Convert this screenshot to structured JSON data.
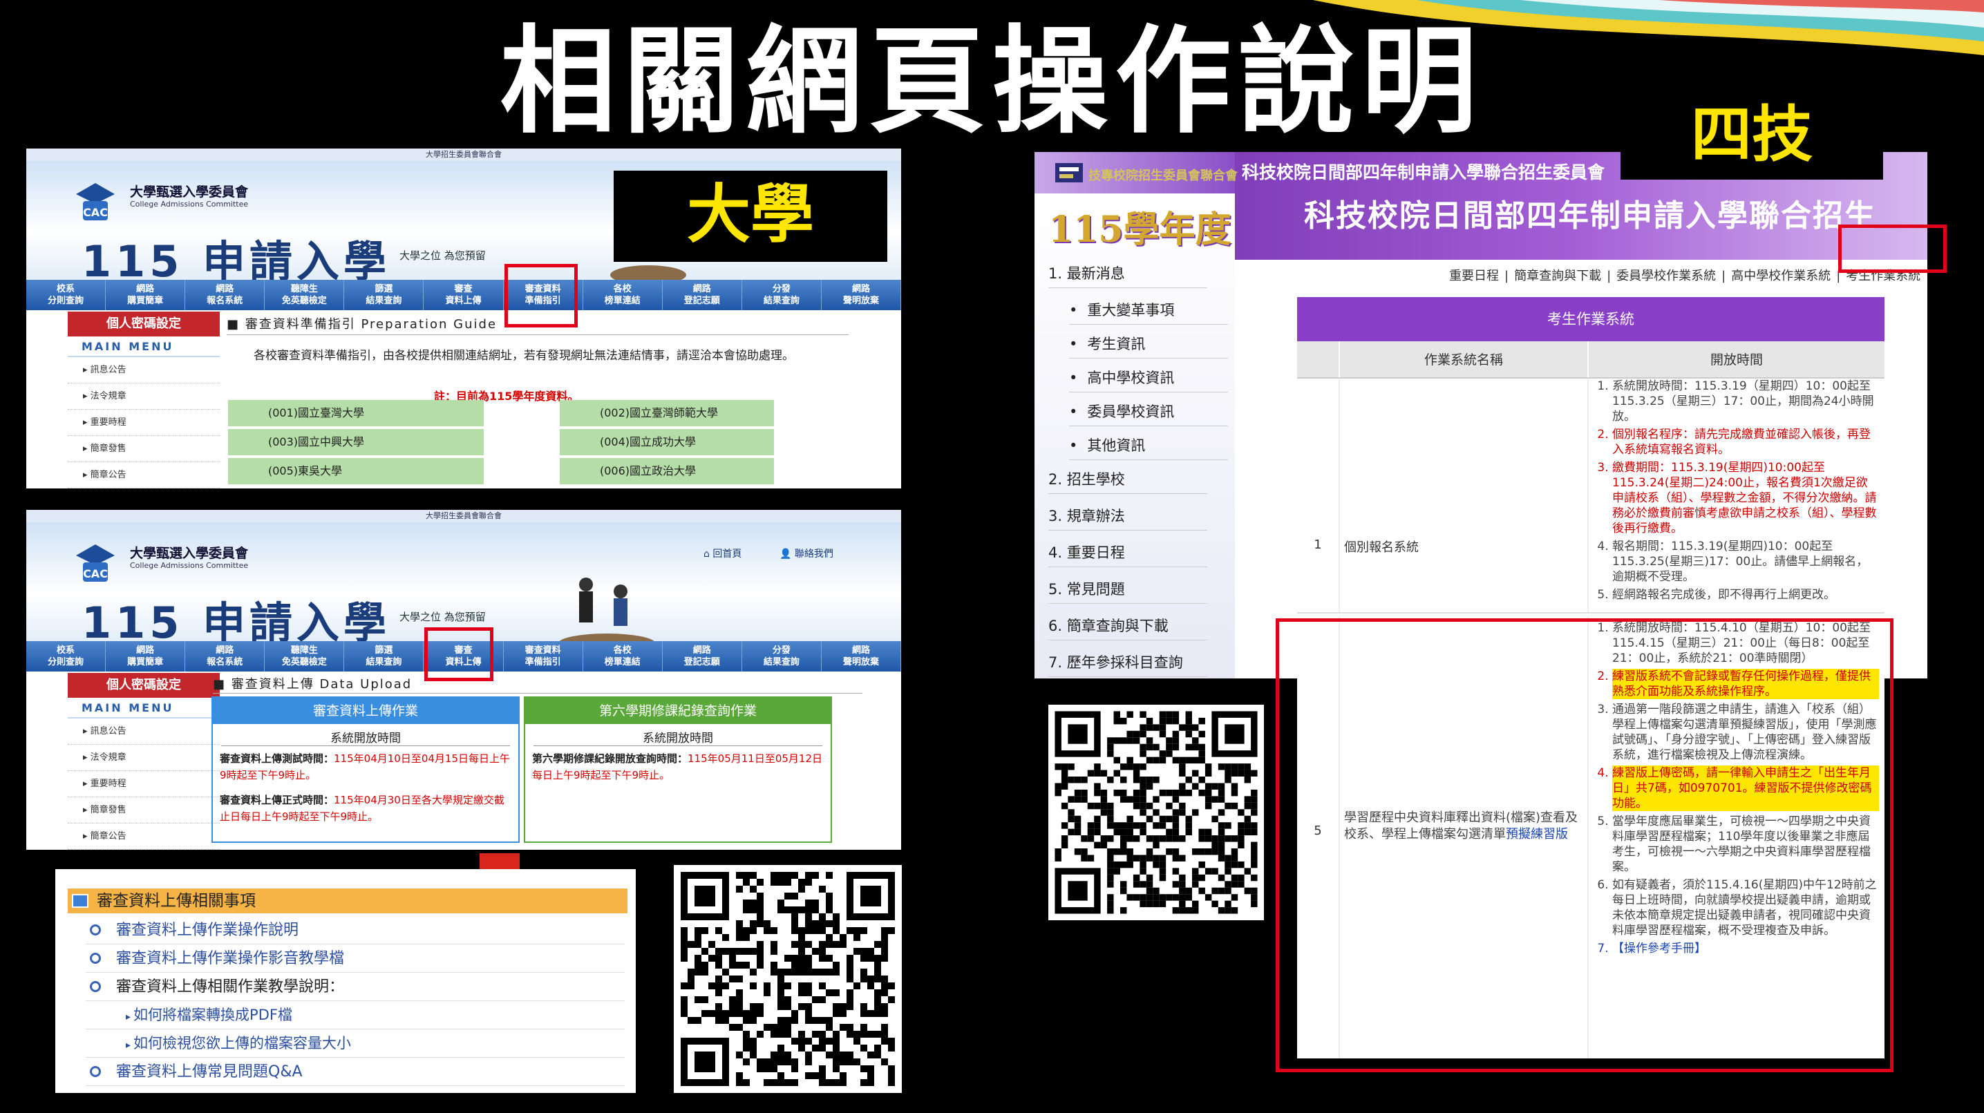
{
  "slide": {
    "title": "相關網頁操作說明",
    "label_univ": "大學",
    "label_tech": "四技"
  },
  "cac": {
    "top_bar": "大學招生委員會聯合會",
    "org_name": "大學甄選入學委員會",
    "org_en": "College Admissions Committee",
    "big_title": "115 申請入學",
    "tagline": "大學之位 為您預留",
    "nav": [
      "校系\n分則查詢",
      "網路\n購買簡章",
      "網路\n報名系統",
      "聽障生\n免英聽檢定",
      "篩選\n結果查詢",
      "審查\n資料上傳",
      "審查資料\n準備指引",
      "各校\n榜單連結",
      "網路\n登記志願",
      "分發\n結果查詢",
      "網路\n聲明放棄"
    ],
    "side_head": "個人密碼設定",
    "side_menu": "MAIN MENU",
    "side_items": [
      "▸ 訊息公告",
      "▸ 法令規章",
      "▸ 重要時程",
      "▸ 簡章發售",
      "▸ 簡章公告"
    ],
    "toplinks": [
      "回首頁",
      "聯絡我們"
    ]
  },
  "panel1": {
    "heading": "審查資料準備指引 Preparation Guide",
    "para": "各校審查資料準備指引，由各校提供相關連結網址，若有發現網址無法連結情事，請逕洽本會協助處理。",
    "note": "註：目前為115學年度資料。",
    "universities": [
      "(001)國立臺灣大學",
      "(002)國立臺灣師範大學",
      "(003)國立中興大學",
      "(004)國立成功大學",
      "(005)東吳大學",
      "(006)國立政治大學"
    ]
  },
  "panel2": {
    "heading": "審查資料上傳 Data Upload",
    "box1_title": "審查資料上傳作業",
    "box1_sub": "系統開放時間",
    "box1_test_label": "審查資料上傳測試時間：",
    "box1_test_value": "115年04月10日至04月15日每日上午9時起至下午9時止。",
    "box1_formal_label": "審查資料上傳正式時間：",
    "box1_formal_value": "115年04月30日至各大學規定繳交截止日每日上午9時起至下午9時止。",
    "box2_title": "第六學期修課紀錄查詢作業",
    "box2_sub": "系統開放時間",
    "box2_label": "第六學期修課紀錄開放查詢時間：",
    "box2_value": "115年05月11日至05月12日每日上午9時起至下午9時止。"
  },
  "panel3": {
    "title": "審查資料上傳相關事項",
    "items": [
      "審查資料上傳作業操作說明",
      "審查資料上傳作業操作影音教學檔",
      "審查資料上傳相關作業教學說明："
    ],
    "subitems": [
      "如何將檔案轉換成PDF檔",
      "如何檢視您欲上傳的檔案容量大小"
    ],
    "last_item": "審查資料上傳常見問題Q&A"
  },
  "tech": {
    "logo_text": "技專校院招生委員會聯合會",
    "org": "科技校院日間部四年制申請入學聯合招生委員會",
    "main_title": "科技校院日間部四年制申請入學聯合招生",
    "year": "115學年度",
    "links": [
      "重要日程",
      "簡章查詢與下載",
      "委員學校作業系統",
      "高中學校作業系統",
      "考生作業系統"
    ],
    "menu": [
      "1.  最新消息",
      "重大變革事項",
      "考生資訊",
      "高中學校資訊",
      "委員學校資訊",
      "其他資訊",
      "2.  招生學校",
      "3.  規章辦法",
      "4.  重要日程",
      "5.  常見問題",
      "6.  簡章查詢與下載",
      "7.  歷年參採科目查詢"
    ],
    "table_title": "考生作業系統",
    "col1": "作業系統名稱",
    "col2": "開放時間",
    "row1": {
      "no": "1",
      "name": "個別報名系統",
      "items": [
        "系統開放時間：115.3.19（星期四）10：00起至115.3.25（星期三）17：00止，期間為24小時開放。",
        "個別報名程序：請先完成繳費並確認入帳後，再登入系統填寫報名資料。",
        "繳費期間：115.3.19(星期四)10:00起至115.3.24(星期二)24:00止，報名費須1次繳足欲申請校系（組）、學程數之金額，不得分次繳納。請務必於繳費前審慎考慮欲申請之校系（組）、學程數後再行繳費。",
        "報名期間：115.3.19(星期四)10：00起至115.3.25(星期三)17：00止。請儘早上網報名，逾期概不受理。",
        "經網路報名完成後，即不得再行上網更改。"
      ]
    },
    "row5": {
      "no": "5",
      "name": "學習歷程中央資料庫釋出資料(檔案)查看及",
      "name2": "校系、學程上傳檔案勾選清單",
      "name_link": "預擬練習版",
      "items": [
        "系統開放時間：115.4.10（星期五）10：00起至115.4.15（星期三）21：00止（每日8：00起至21：00止，系統於21：00準時關閉）",
        "練習版系統不會記錄或暫存任何操作過程，僅提供熟悉介面功能及系統操作程序。",
        "通過第一階段篩選之申請生，請進入「校系（組）學程上傳檔案勾選清單預擬練習版」，使用「學測應試號碼」、「身分證字號」、「上傳密碼」登入練習版系統，進行檔案檢視及上傳流程演練。",
        "練習版上傳密碼，請一律輸入申請生之「出生年月日」共7碼，如0970701。練習版不提供修改密碼功能。",
        "當學年度應屆畢業生，可檢視一～四學期之中央資料庫學習歷程檔案；110學年度以後畢業之非應屆考生，可檢視一～六學期之中央資料庫學習歷程檔案。",
        "如有疑義者，須於115.4.16(星期四)中午12時前之每日上班時間，向就讀學校提出疑義申請，逾期或未依本簡章規定提出疑義申請者，視同確認中央資料庫學習歷程檔案，概不受理複查及申訴。",
        "【操作參考手冊】"
      ]
    }
  },
  "colors": {
    "red": "#e0001a",
    "yellow": "#ffe600",
    "purple": "#8a3fc9",
    "nav_blue": "#2a63b0"
  }
}
